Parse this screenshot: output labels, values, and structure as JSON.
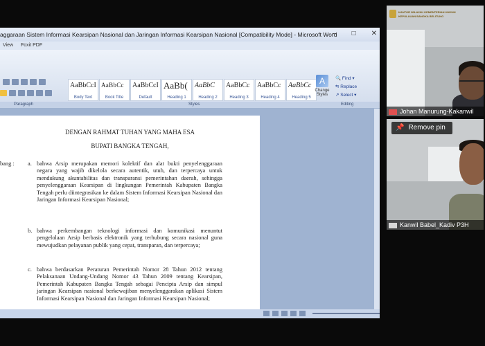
{
  "word": {
    "title": "aggaraan Sistem Informasi Kearsipan Nasional dan Jaringan Informasi Kearsipan Nasional [Compatibility Mode] - Microsoft Word",
    "tabs": [
      "View",
      "Foxit PDF"
    ],
    "styles": [
      {
        "sample": "AaBbCcI",
        "name": "Body Text"
      },
      {
        "sample": "AaBbCc",
        "name": "Book Title"
      },
      {
        "sample": "AaBbCcI",
        "name": "Default"
      },
      {
        "sample": "AaBb(",
        "name": "Heading 1"
      },
      {
        "sample": "AaBbC",
        "name": "Heading 2"
      },
      {
        "sample": "AaBbCc",
        "name": "Heading 3"
      },
      {
        "sample": "AaBbCc",
        "name": "Heading 4"
      },
      {
        "sample": "AaBbCc",
        "name": "Heading 5"
      }
    ],
    "change_styles": "Change Styles",
    "editing": {
      "find": "Find",
      "replace": "Replace",
      "select": "Select"
    },
    "groups": {
      "paragraph": "Paragraph",
      "styles": "Styles",
      "editing": "Editing"
    }
  },
  "document": {
    "heading1": "DENGAN RAHMAT TUHAN YANG MAHA ESA",
    "heading2": "BUPATI BANGKA TENGAH,",
    "label": "bang  :",
    "items": [
      {
        "letter": "a.",
        "text": "bahwa Arsip merupakan memori kolektif dan alat bukti penyelenggaraan negara yang wajib dikelola secara autentik, utuh, dan terpercaya untuk mendukung akuntabilitas dan transparansi pemerintahan daerah, sehingga penyelenggaraan Kearsipan di lingkungan Pemerintah Kabupaten Bangka Tengah perlu diintegrasikan ke dalam Sistem Informasi Kearsipan Nasional dan Jaringan Informasi Kearsipan Nasional;"
      },
      {
        "letter": "b.",
        "text": "bahwa perkembangan teknologi informasi dan komunikasi menuntut pengelolaan Arsip berbasis elektronik yang terhubung secara nasional guna mewujudkan pelayanan publik yang cepat, transparan, dan terpercaya;"
      },
      {
        "letter": "c.",
        "text": "bahwa berdasarkan Peraturan Pemerintah Nomor 28 Tahun 2012 tentang Pelaksanaan Undang-Undang Nomor 43 Tahun 2009 tentang Kearsipan, Pemerintah Kabupaten Bangka Tengah sebagai Pencipta Arsip dan simpul jaringan Kearsipan nasional berkewajiban menyelenggarakan aplikasi Sistem Informasi Kearsipan Nasional dan Jaringan Informasi Kearsipan Nasional;"
      }
    ]
  },
  "participants": [
    {
      "name": "Johan Manurung-Kakanwil",
      "logo_line1": "KANTOR WILAYAH KEMENTERIAN HUKUM",
      "logo_line2": "KEPULAUAN BANGKA BELITUNG"
    },
    {
      "name": "Kanwil Babel_Kadiv P3H",
      "pin_label": "Remove pin"
    }
  ],
  "colors": {
    "mic": "#e05050"
  }
}
